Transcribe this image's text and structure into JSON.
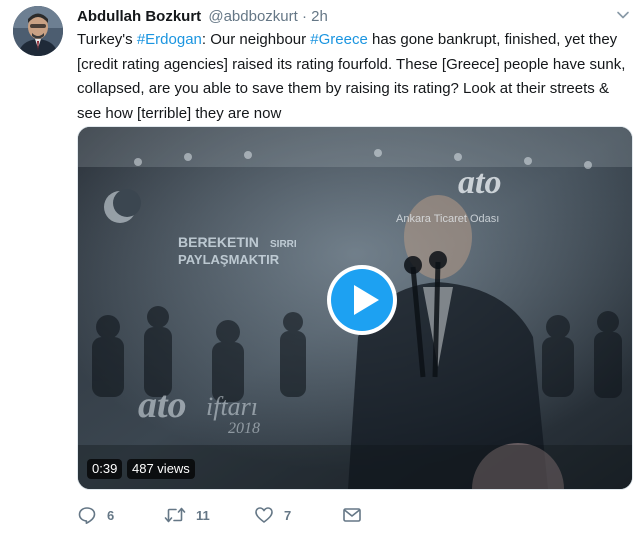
{
  "tweet": {
    "author_name": "Abdullah Bozkurt",
    "author_handle": "@abdbozkurt",
    "separator": "·",
    "time": "2h",
    "text": {
      "part1": "Turkey's ",
      "hashtag1": "#Erdogan",
      "part2": ": Our neighbour ",
      "hashtag2": "#Greece",
      "part3": " has gone bankrupt, finished, yet they [credit rating agencies] raised its rating fourfold. These [Greece] people have sunk, collapsed, are you able to save them by raising its rating? Look at their streets & see how [terrible] they are now"
    }
  },
  "video": {
    "duration": "0:39",
    "views": "487 views",
    "overlay_texts": {
      "brand_top": "ato",
      "brand_sub": "Ankara Ticaret Odası",
      "banner_line1": "BEREKETIN",
      "banner_line1b": "SIRRI",
      "banner_line2": "PAYLAŞMAKTIR",
      "iftar_logo": "ato",
      "iftar_script": "iftarı",
      "iftar_year": "2018"
    }
  },
  "actions": {
    "reply_count": "6",
    "retweet_count": "11",
    "like_count": "7"
  },
  "icons": {
    "caret": "chevron-down-icon",
    "play": "play-icon",
    "reply": "reply-icon",
    "retweet": "retweet-icon",
    "like": "heart-icon",
    "dm": "envelope-icon"
  },
  "colors": {
    "link": "#1b95e0",
    "muted": "#657786",
    "text": "#14171a",
    "play_button": "#1da1f2"
  }
}
